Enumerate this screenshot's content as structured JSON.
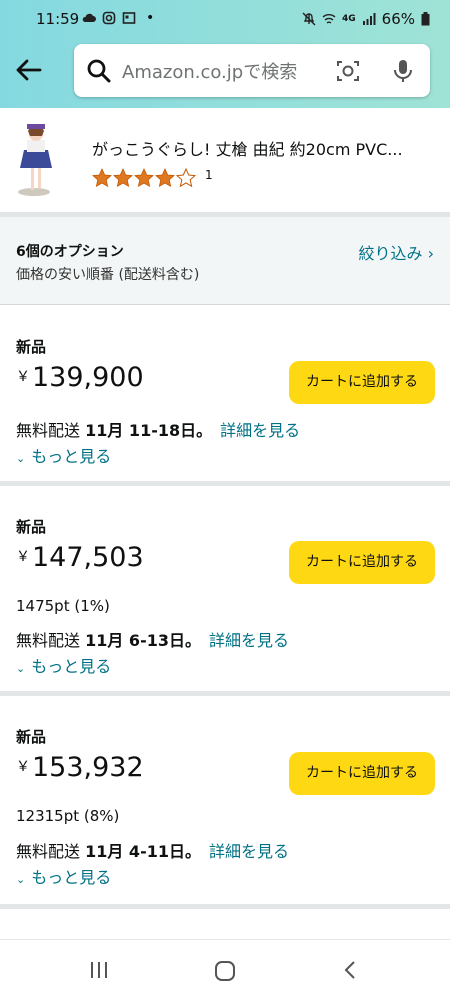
{
  "status_bar": {
    "time": "11:59",
    "battery": "66%",
    "network": "4G"
  },
  "search": {
    "placeholder": "Amazon.co.jpで検索"
  },
  "product": {
    "title": "がっこうぐらし! 丈槍 由紀 約20cm PVC...",
    "rating": 4,
    "review_count": "1"
  },
  "options": {
    "count_label": "6個のオプション",
    "sort_label": "価格の安い順番 (配送料含む)",
    "filter_label": "絞り込み ›"
  },
  "offers": [
    {
      "condition": "新品",
      "currency": "￥",
      "price": "139,900",
      "points": "",
      "ship_prefix": "無料配送 ",
      "ship_date": "11月 11-18日。",
      "details": "詳細を見る",
      "more": "もっと見る",
      "cart_label": "カートに追加する"
    },
    {
      "condition": "新品",
      "currency": "￥",
      "price": "147,503",
      "points": "1475pt (1%)",
      "ship_prefix": "無料配送 ",
      "ship_date": "11月 6-13日。",
      "details": "詳細を見る",
      "more": "もっと見る",
      "cart_label": "カートに追加する"
    },
    {
      "condition": "新品",
      "currency": "￥",
      "price": "153,932",
      "points": "12315pt (8%)",
      "ship_prefix": "無料配送 ",
      "ship_date": "11月 4-11日。",
      "details": "詳細を見る",
      "more": "もっと見る",
      "cart_label": "カートに追加する"
    }
  ],
  "colors": {
    "cart_button": "#ffd814",
    "link": "#007185",
    "star": "#de7921",
    "header_start": "#84d9e0",
    "header_end": "#9fe3d6"
  }
}
